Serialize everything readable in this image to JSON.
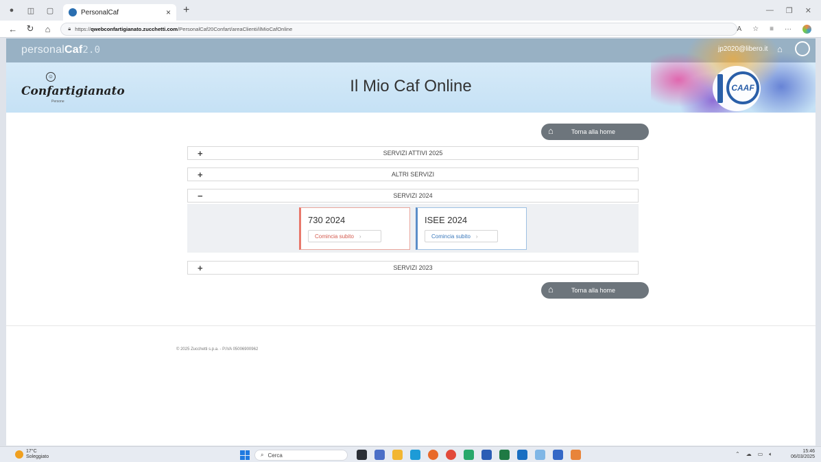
{
  "browser": {
    "tab_title": "PersonalCaf",
    "url_prefix": "https://",
    "url_host": "qwebconfartigianato.zucchetti.com",
    "url_path": "/PersonalCaf20Confart/areaClienti/ilMioCafOnline"
  },
  "header": {
    "brand_personal": "personal",
    "brand_caf": "Caf",
    "brand_version": "2.0",
    "user_email": "jp2020@libero.it",
    "logo_name": "Confartigianato",
    "logo_sub": "Persone",
    "caaf_text": "CAAF"
  },
  "main": {
    "title": "Il Mio Caf Online",
    "home_label": "Torna alla home",
    "sections": [
      {
        "label": "SERVIZI ATTIVI 2025",
        "sign": "+"
      },
      {
        "label": "ALTRI SERVIZI",
        "sign": "+"
      },
      {
        "label": "SERVIZI 2024",
        "sign": "−"
      },
      {
        "label": "SERVIZI 2023",
        "sign": "+"
      }
    ],
    "cards": [
      {
        "title": "730 2024",
        "button": "Comincia subito"
      },
      {
        "title": "ISEE 2024",
        "button": "Comincia subito"
      }
    ]
  },
  "footer": {
    "copyright": "© 2025 Zucchetti s.p.a. - P.IVA 05006900962"
  },
  "taskbar": {
    "temp": "17°C",
    "weather": "Soleggiato",
    "search": "Cerca",
    "time": "15:46",
    "date": "06/03/2025"
  }
}
